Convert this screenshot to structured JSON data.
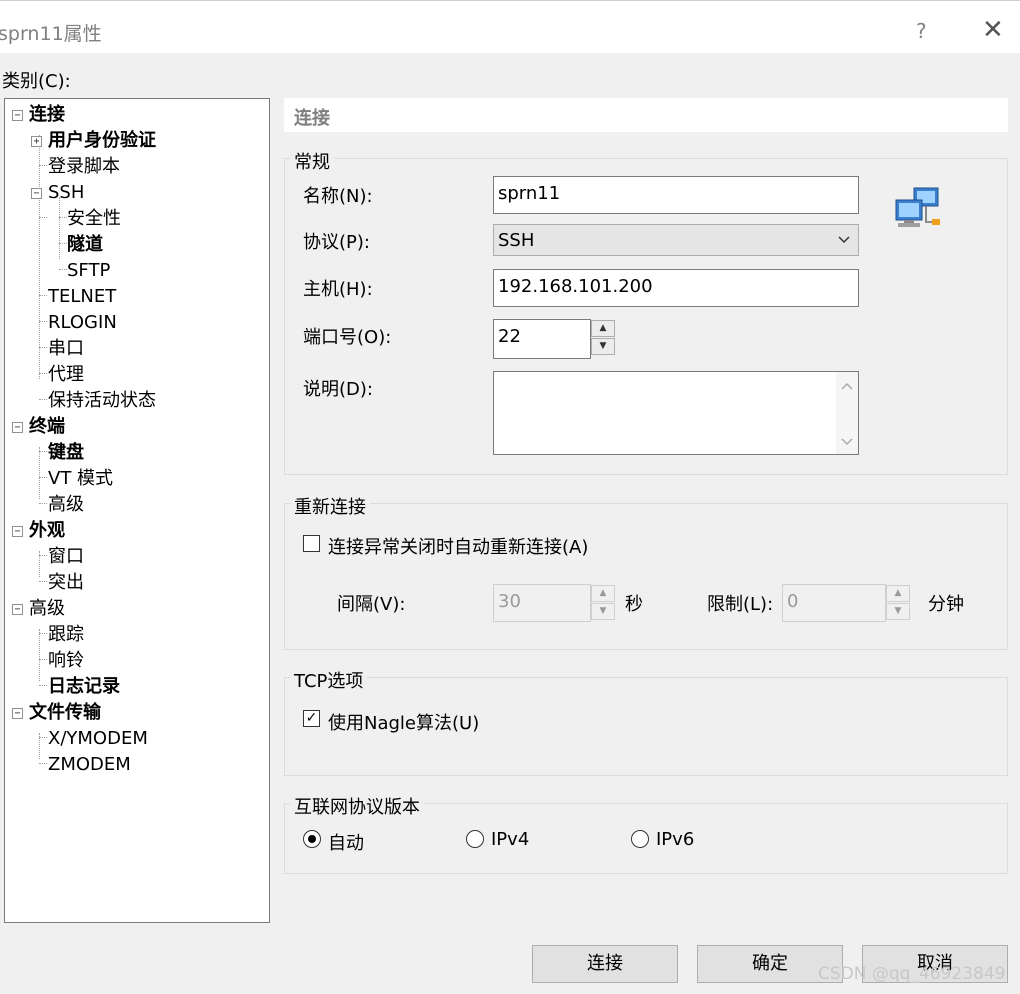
{
  "window": {
    "title": "sprn11属性",
    "help": "?",
    "close": "✕"
  },
  "category_label": "类别(C):",
  "tree": [
    {
      "label": "连接",
      "bold": true
    },
    {
      "label": "用户身份验证",
      "bold": true
    },
    {
      "label": "登录脚本",
      "bold": false
    },
    {
      "label": "SSH",
      "bold": false
    },
    {
      "label": "安全性",
      "bold": false
    },
    {
      "label": "隧道",
      "bold": true
    },
    {
      "label": "SFTP",
      "bold": false
    },
    {
      "label": "TELNET",
      "bold": false
    },
    {
      "label": "RLOGIN",
      "bold": false
    },
    {
      "label": "串口",
      "bold": false
    },
    {
      "label": "代理",
      "bold": false
    },
    {
      "label": "保持活动状态",
      "bold": false
    },
    {
      "label": "终端",
      "bold": true
    },
    {
      "label": "键盘",
      "bold": true
    },
    {
      "label": "VT 模式",
      "bold": false
    },
    {
      "label": "高级",
      "bold": false
    },
    {
      "label": "外观",
      "bold": true
    },
    {
      "label": "窗口",
      "bold": false
    },
    {
      "label": "突出",
      "bold": false
    },
    {
      "label": "高级",
      "bold": false
    },
    {
      "label": "跟踪",
      "bold": false
    },
    {
      "label": "响铃",
      "bold": false
    },
    {
      "label": "日志记录",
      "bold": true
    },
    {
      "label": "文件传输",
      "bold": true
    },
    {
      "label": "X/YMODEM",
      "bold": false
    },
    {
      "label": "ZMODEM",
      "bold": false
    }
  ],
  "section_title": "连接",
  "general": {
    "title": "常规",
    "name_label": "名称(N):",
    "name_value": "sprn11",
    "protocol_label": "协议(P):",
    "protocol_value": "SSH",
    "host_label": "主机(H):",
    "host_value": "192.168.101.200",
    "port_label": "端口号(O):",
    "port_value": "22",
    "desc_label": "说明(D):",
    "desc_value": ""
  },
  "reconnect": {
    "title": "重新连接",
    "auto_label": "连接异常关闭时自动重新连接(A)",
    "auto_checked": false,
    "interval_label": "间隔(V):",
    "interval_value": "30",
    "interval_unit": "秒",
    "limit_label": "限制(L):",
    "limit_value": "0",
    "limit_unit": "分钟"
  },
  "tcp": {
    "title": "TCP选项",
    "nagle_label": "使用Nagle算法(U)",
    "nagle_checked": true
  },
  "ip": {
    "title": "互联网协议版本",
    "options": [
      "自动",
      "IPv4",
      "IPv6"
    ],
    "selected": "自动"
  },
  "buttons": {
    "connect": "连接",
    "ok": "确定",
    "cancel": "取消"
  },
  "watermark": "CSDN @qq_46923849",
  "icons": {
    "network": "network-computers-icon",
    "check": "✓",
    "up": "▲",
    "down": "▼"
  }
}
